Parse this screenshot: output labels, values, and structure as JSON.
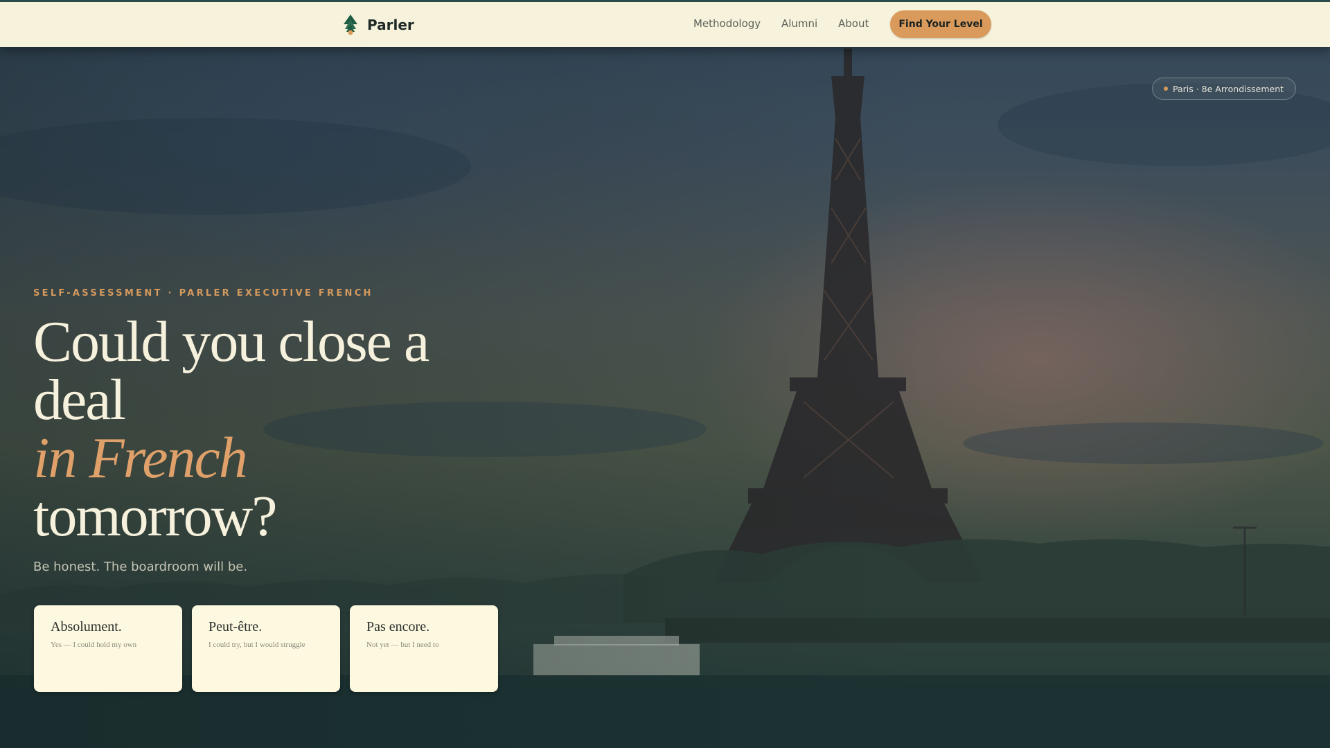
{
  "colors": {
    "accent": "#d99a5c",
    "nav_bg": "#f6f2dc",
    "card_bg": "#fdf8e0",
    "headline": "#f6f1dc",
    "headline_accent": "#dfa06a"
  },
  "navbar": {
    "brand_name": "Parler",
    "brand_icon": "fir-tree-icon",
    "links": [
      "Methodology",
      "Alumni",
      "About"
    ],
    "cta_label": "Find Your Level"
  },
  "location_badge": "Paris · 8e Arrondissement",
  "hero": {
    "eyebrow": "SELF-ASSESSMENT · PARLER EXECUTIVE FRENCH",
    "headline_line1": "Could you close a deal",
    "headline_accent": "in French",
    "headline_line3": "tomorrow?",
    "subline": "Be honest. The boardroom will be."
  },
  "answers": [
    {
      "title": "Absolument.",
      "subtitle": "Yes — I could hold my own"
    },
    {
      "title": "Peut-être.",
      "subtitle": "I could try, but I would struggle"
    },
    {
      "title": "Pas encore.",
      "subtitle": "Not yet — but I need to"
    }
  ]
}
